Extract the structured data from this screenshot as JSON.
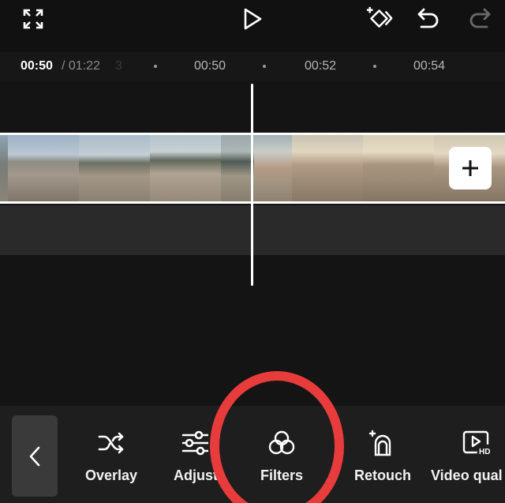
{
  "top_bar": {
    "icons": [
      "fullscreen-icon",
      "play-icon",
      "keyframe-icon",
      "undo-icon",
      "redo-icon"
    ]
  },
  "ruler": {
    "current_time": "00:50",
    "total_time": "/ 01:22",
    "ghost_digit": "3",
    "ticks": [
      "00:50",
      "00:52",
      "00:54"
    ]
  },
  "timeline": {
    "add_clip_label": "+"
  },
  "toolbar": {
    "back_icon": "chevron-left-icon",
    "tools": [
      {
        "label": "Overlay",
        "icon": "shuffle-icon"
      },
      {
        "label": "Adjust",
        "icon": "sliders-icon"
      },
      {
        "label": "Filters",
        "icon": "filters-icon"
      },
      {
        "label": "Retouch",
        "icon": "retouch-icon"
      },
      {
        "label": "Video qual",
        "icon": "video-hd-icon"
      }
    ]
  },
  "colors": {
    "highlight": "#e83b3b",
    "background": "#141414",
    "toolbar": "#1e1e1e"
  }
}
